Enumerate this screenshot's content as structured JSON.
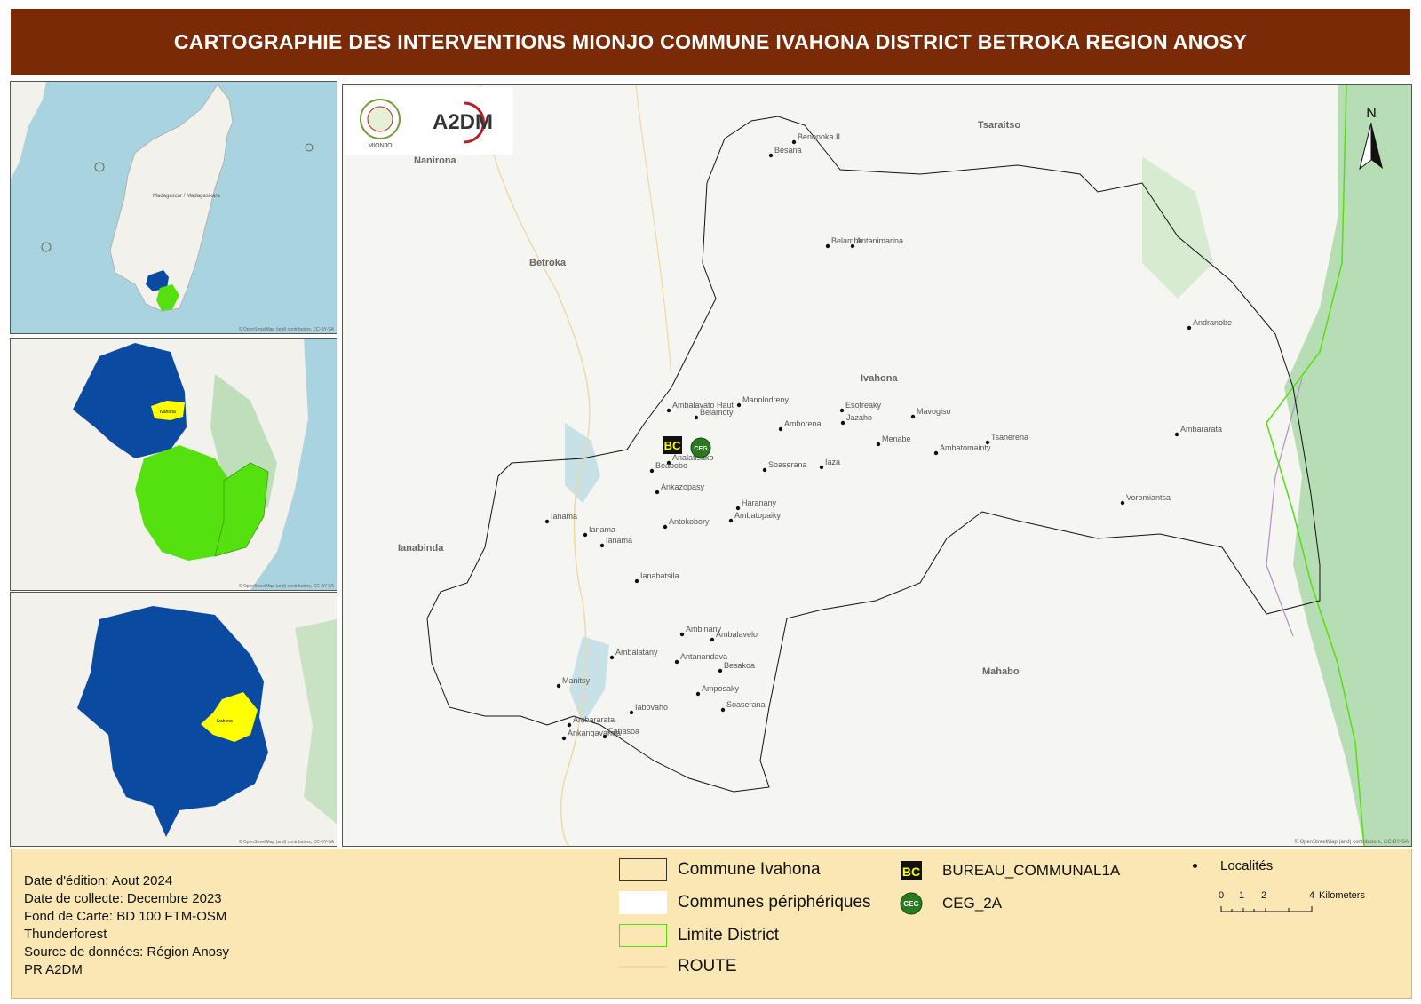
{
  "title": "CARTOGRAPHIE DES INTERVENTIONS MIONJO COMMUNE IVAHONA DISTRICT BETROKA REGION ANOSY",
  "colors": {
    "title_bg": "#7a2a05",
    "legend_bg": "#fbe7b4",
    "region_fill": "#0a4aa0",
    "district_fill": "#55e010",
    "commune_fill": "#ffff00",
    "sea": "#a9d3df",
    "land": "#f2f1ec",
    "forest": "#9dd39a"
  },
  "insets": {
    "madagascar": {
      "label": "Madagascar / Madagasikara",
      "credit": "© OpenStreetMap (and) contributors, CC-BY-SA"
    },
    "region": {
      "label": "Ivahona",
      "credit": "© OpenStreetMap (and) contributors, CC-BY-SA"
    },
    "district": {
      "label": "Ivahona",
      "credit": "© OpenStreetMap (and) contributors, CC-BY-SA"
    }
  },
  "main_map": {
    "credit": "© OpenStreetMap (and) contributors, CC-BY-SA",
    "north_label": "N",
    "neighbour_communes": [
      "Nanirona",
      "Betroka",
      "Ianabinda",
      "Tsaraitso",
      "Mahabo",
      "Ivahona"
    ],
    "localities": [
      "Benonoka II",
      "Besana",
      "Belambo",
      "Antanimarina",
      "Andranobe",
      "Ambalavato Haut",
      "Manolodreny",
      "Belamoty",
      "Esotreaky",
      "Mavogiso",
      "Amborena",
      "Jazaho",
      "Menabe",
      "Tsanerena",
      "Ambatomainty",
      "Ambararata",
      "Analafisako",
      "Beabobo",
      "Soaserana",
      "Iaza",
      "Ankazopasy",
      "Voromiantsa",
      "Haranany",
      "Ambatopaiky",
      "Ianama",
      "Ianama",
      "Ianama",
      "Antokobory",
      "Ianabatsila",
      "Ambinany",
      "Ambalavelo",
      "Ambalatany",
      "Antanandava",
      "Besakoa",
      "Manitsy",
      "Amposaky",
      "Soaserana",
      "Iabovaho",
      "Ambararata",
      "Ankangavanda",
      "Fanasoa"
    ],
    "markers": {
      "bureau": "BC",
      "ceg": "CEG"
    },
    "logos": {
      "mionjo": "MIONJO",
      "a2dm": "A2DM"
    }
  },
  "legend": {
    "meta": [
      "Date d'édition: Aout 2024",
      "Date de collecte: Decembre 2023",
      "Fond de Carte: BD 100 FTM-OSM",
      "Thunderforest",
      "Source de données: Région Anosy",
      "PR A2DM"
    ],
    "commune": "Commune Ivahona",
    "peripheral": "Communes périphériques",
    "district_limit": "Limite District",
    "route": "ROUTE",
    "bureau": "BUREAU_COMMUNAL1A",
    "bureau_icon": "BC",
    "ceg": "CEG_2A",
    "ceg_icon": "CEG",
    "localites": "Localités",
    "scale_ticks": [
      "0",
      "1",
      "2",
      "4"
    ],
    "scale_unit": "Kilometers"
  }
}
